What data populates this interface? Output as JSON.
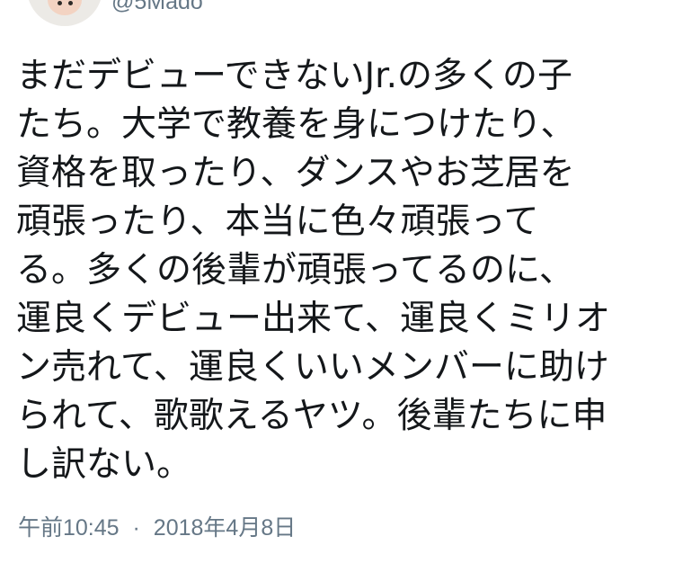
{
  "tweet": {
    "handle": "@5Mado",
    "text": "まだデビューできないJr.の多くの子\nたち。大学で教養を身につけたり、\n資格を取ったり、ダンスやお芝居を\n頑張ったり、本当に色々頑張って\nる。多くの後輩が頑張ってるのに、\n運良くデビュー出来て、運良くミリオ\nン売れて、運良くいいメンバーに助け\nられて、歌歌えるヤツ。後輩たちに申\nし訳ない。",
    "time": "午前10:45",
    "separator": "·",
    "date": "2018年4月8日"
  },
  "colors": {
    "text": "#14171a",
    "secondary_text": "#657786",
    "background": "#ffffff"
  },
  "icons": {
    "avatar": "profile-avatar"
  }
}
